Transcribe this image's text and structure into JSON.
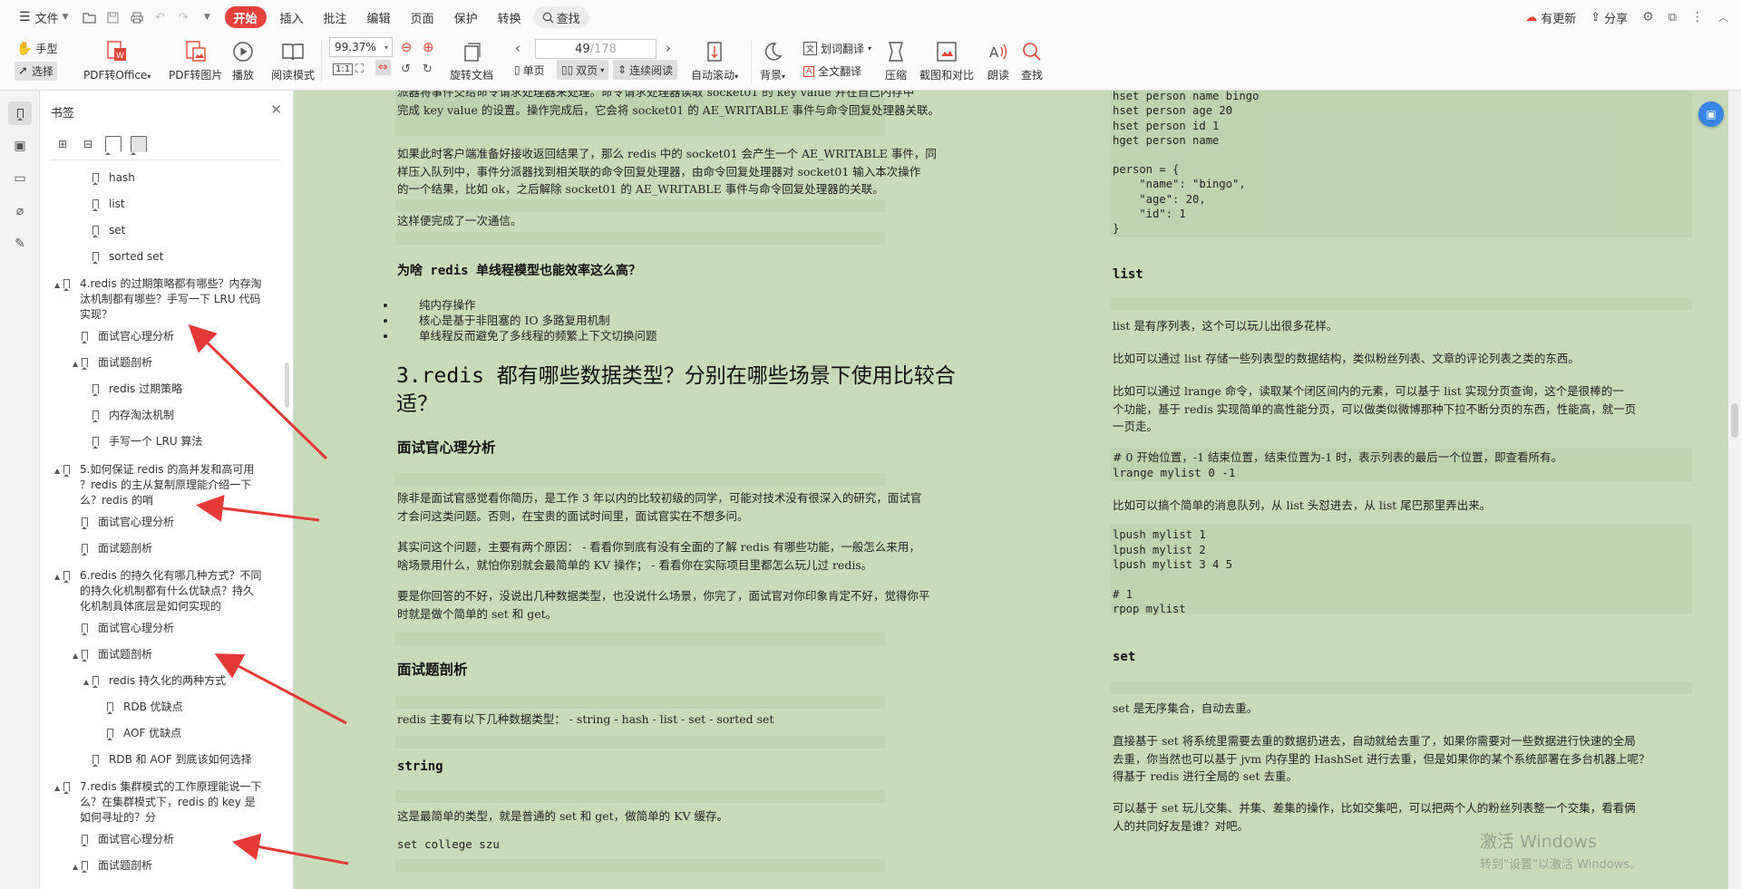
{
  "menu": {
    "file": "文件",
    "start": "开始",
    "items": [
      "插入",
      "批注",
      "编辑",
      "页面",
      "保护",
      "转换"
    ],
    "search": "查找",
    "right": {
      "update": "有更新",
      "share": "分享"
    }
  },
  "toolbar": {
    "hand": "手型",
    "select": "选择",
    "pdf_office": "PDF转Office",
    "pdf_image": "PDF转图片",
    "play": "播放",
    "read_mode": "阅读模式",
    "zoom": "99.37%",
    "rotate": "旋转文档",
    "single": "单页",
    "double": "双页",
    "continuous": "连续阅读",
    "page_current": "49",
    "page_total": "/178",
    "auto_scroll": "自动滚动",
    "background": "背景",
    "word_translate": "划词翻译",
    "full_translate": "全文翻译",
    "compress": "压缩",
    "screenshot_compare": "截图和对比",
    "read_aloud": "朗读",
    "find": "查找"
  },
  "bookmarks": {
    "title": "书签",
    "items": [
      {
        "label": "hash",
        "level": 3,
        "tri": ""
      },
      {
        "label": "list",
        "level": 3,
        "tri": ""
      },
      {
        "label": "set",
        "level": 3,
        "tri": ""
      },
      {
        "label": "sorted set",
        "level": 3,
        "tri": ""
      },
      {
        "label": "4.redis 的过期策略都有哪些？内存淘\n汰机制都有哪些？手写一下 LRU 代码\n实现？",
        "level": 1,
        "tri": "▲"
      },
      {
        "label": "面试官心理分析",
        "level": 2,
        "tri": ""
      },
      {
        "label": "面试题剖析",
        "level": 2,
        "tri": "▲"
      },
      {
        "label": "redis 过期策略",
        "level": 3,
        "tri": ""
      },
      {
        "label": "内存淘汰机制",
        "level": 3,
        "tri": ""
      },
      {
        "label": "手写一个 LRU 算法",
        "level": 3,
        "tri": ""
      },
      {
        "label": "5.如何保证 redis 的高并发和高可用\n？redis 的主从复制原理能介绍一下\n么？redis 的哨",
        "level": 1,
        "tri": "▲"
      },
      {
        "label": "面试官心理分析",
        "level": 2,
        "tri": ""
      },
      {
        "label": "面试题剖析",
        "level": 2,
        "tri": ""
      },
      {
        "label": "6.redis 的持久化有哪几种方式？不同\n的持久化机制都有什么优缺点？持久\n化机制具体底层是如何实现的",
        "level": 1,
        "tri": "▲"
      },
      {
        "label": "面试官心理分析",
        "level": 2,
        "tri": ""
      },
      {
        "label": "面试题剖析",
        "level": 2,
        "tri": "▲"
      },
      {
        "label": "redis 持久化的两种方式",
        "level": 3,
        "tri": "▲"
      },
      {
        "label": "RDB 优缺点",
        "level": 4,
        "tri": ""
      },
      {
        "label": "AOF 优缺点",
        "level": 4,
        "tri": ""
      },
      {
        "label": "RDB 和 AOF 到底该如何选择",
        "level": 3,
        "tri": ""
      },
      {
        "label": "7.redis 集群模式的工作原理能说一下\n么？在集群模式下，redis 的 key 是\n如何寻址的？分",
        "level": 1,
        "tri": "▲"
      },
      {
        "label": "面试官心理分析",
        "level": 2,
        "tri": ""
      },
      {
        "label": "面试题剖析",
        "level": 2,
        "tri": "▲"
      }
    ]
  },
  "left_page": {
    "para1_l1": "派器将事件交给命令请求处理器来处理。命令请求处理器读取 socket01 的 key value 并在自己内存中",
    "para1_l2": "完成 key value 的设置。操作完成后，它会将 socket01 的 AE_WRITABLE 事件与命令回复处理器关联。",
    "para2_l1": "如果此时客户端准备好接收返回结果了，那么 redis 中的 socket01 会产生一个 AE_WRITABLE 事件，同",
    "para2_l2": "样压入队列中，事件分派器找到相关联的命令回复处理器，由命令回复处理器对 socket01 输入本次操作",
    "para2_l3": "的一个结果，比如 ok，之后解除 socket01 的 AE_WRITABLE 事件与命令回复处理器的关联。",
    "para3": "这样便完成了一次通信。",
    "h_why": "为啥 redis 单线程模型也能效率这么高？",
    "bullets": [
      "纯内存操作",
      "核心是基于非阻塞的 IO 多路复用机制",
      "单线程反而避免了多线程的频繁上下文切换问题"
    ],
    "h1_l1": "3.redis 都有哪些数据类型？分别在哪些场景下使用比较合",
    "h1_l2": "适？",
    "h_psych": "面试官心理分析",
    "psych_p1_l1": "除非是面试官感觉看你简历，是工作 3 年以内的比较初级的同学，可能对技术没有很深入的研究，面试官",
    "psych_p1_l2": "才会问这类问题。否则，在宝贵的面试时间里，面试官实在不想多问。",
    "psych_p2_l1": "其实问这个问题，主要有两个原因： - 看看你到底有没有全面的了解 redis 有哪些功能，一般怎么来用，",
    "psych_p2_l2": "啥场景用什么，就怕你别就会最简单的 KV 操作； - 看看你在实际项目里都怎么玩儿过 redis。",
    "psych_p3_l1": "要是你回答的不好，没说出几种数据类型，也没说什么场景，你完了，面试官对你印象肯定不好，觉得你平",
    "psych_p3_l2": "时就是做个简单的 set 和 get。",
    "h_analysis": "面试题剖析",
    "types": "redis 主要有以下几种数据类型： - string - hash - list - set - sorted set",
    "h_string": "string",
    "string_p": "这是最简单的类型，就是普通的 set 和 get，做简单的 KV 缓存。",
    "string_code": "set college szu"
  },
  "right_page": {
    "code1": [
      "hset person name bingo",
      "hset person age 20",
      "hset person id 1",
      "hget person name",
      "",
      "person = {",
      "    \"name\": \"bingo\",",
      "    \"age\": 20,",
      "    \"id\": 1",
      "}"
    ],
    "h_list": "list",
    "list_p1": "list 是有序列表，这个可以玩儿出很多花样。",
    "list_p2": "比如可以通过 list 存储一些列表型的数据结构，类似粉丝列表、文章的评论列表之类的东西。",
    "list_p3_l1": "比如可以通过 lrange 命令，读取某个闭区间内的元素，可以基于 list 实现分页查询，这个是很棒的一",
    "list_p3_l2": "个功能，基于 redis 实现简单的高性能分页，可以做类似微博那种下拉不断分页的东西，性能高，就一页",
    "list_p3_l3": "一页走。",
    "list_code1_l1": "# 0 开始位置，-1 结束位置，结束位置为-1 时，表示列表的最后一个位置，即查看所有。",
    "list_code1_l2": "lrange mylist 0 -1",
    "list_p4": "比如可以搞个简单的消息队列，从 list 头怼进去，从 list 尾巴那里弄出来。",
    "list_code2": [
      "lpush mylist 1",
      "lpush mylist 2",
      "lpush mylist 3 4 5",
      "",
      "# 1",
      "rpop mylist"
    ],
    "h_set": "set",
    "set_p1": "set 是无序集合，自动去重。",
    "set_p2_l1": "直接基于 set 将系统里需要去重的数据扔进去，自动就给去重了，如果你需要对一些数据进行快速的全局",
    "set_p2_l2": "去重，你当然也可以基于 jvm 内存里的 HashSet 进行去重，但是如果你的某个系统部署在多台机器上呢？",
    "set_p2_l3": "得基于 redis 进行全局的 set 去重。",
    "set_p3_l1": "可以基于 set 玩儿交集、并集、差集的操作，比如交集吧，可以把两个人的粉丝列表整一个交集，看看俩",
    "set_p3_l2": "人的共同好友是谁？对吧。"
  },
  "watermark": {
    "title": "激活 Windows",
    "sub": "转到\"设置\"以激活 Windows。"
  }
}
